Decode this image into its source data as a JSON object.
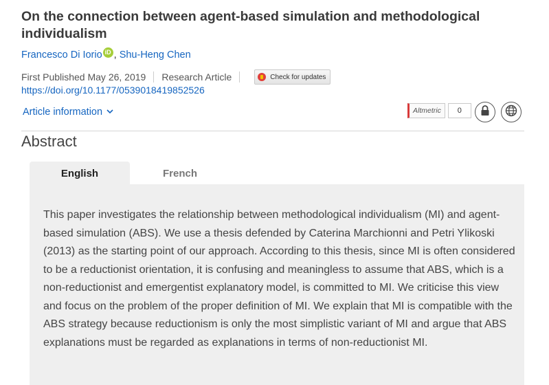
{
  "article": {
    "title": "On the connection between agent-based simulation and methodological individualism",
    "authors": [
      {
        "name": "Francesco Di Iorio",
        "orcid": true
      },
      {
        "name": "Shu-Heng Chen",
        "orcid": false
      }
    ],
    "orcid_label": "iD",
    "author_sep": ",",
    "first_published": "First Published May 26, 2019",
    "article_type": "Research Article",
    "check_updates_label": "Check for updates",
    "doi": "https://doi.org/10.1177/0539018419852526",
    "article_info_label": "Article information",
    "altmetric_label": "Altmetric",
    "altmetric_count": "0"
  },
  "icons": {
    "lock": "lock-icon",
    "globe": "globe-icon",
    "chevron": "chevron-down-icon"
  },
  "abstract": {
    "heading": "Abstract",
    "tabs": [
      {
        "label": "English",
        "active": true
      },
      {
        "label": "French",
        "active": false
      }
    ],
    "text": "This paper investigates the relationship between methodological individualism (MI) and agent-based simulation (ABS). We use a thesis defended by Caterina Marchionni and Petri Ylikoski (2013) as the starting point of our approach. According to this thesis, since MI is often considered to be a reductionist orientation, it is confusing and meaningless to assume that ABS, which is a non-reductionist and emergentist explanatory model, is committed to MI. We criticise this view and focus on the problem of the proper definition of MI. We explain that MI is compatible with the ABS strategy because reductionism is only the most simplistic variant of MI and argue that ABS explanations must be regarded as explanations in terms of non-reductionist MI."
  },
  "colors": {
    "link": "#1565c0",
    "orcid": "#a6ce39",
    "panel_bg": "#efefef"
  }
}
